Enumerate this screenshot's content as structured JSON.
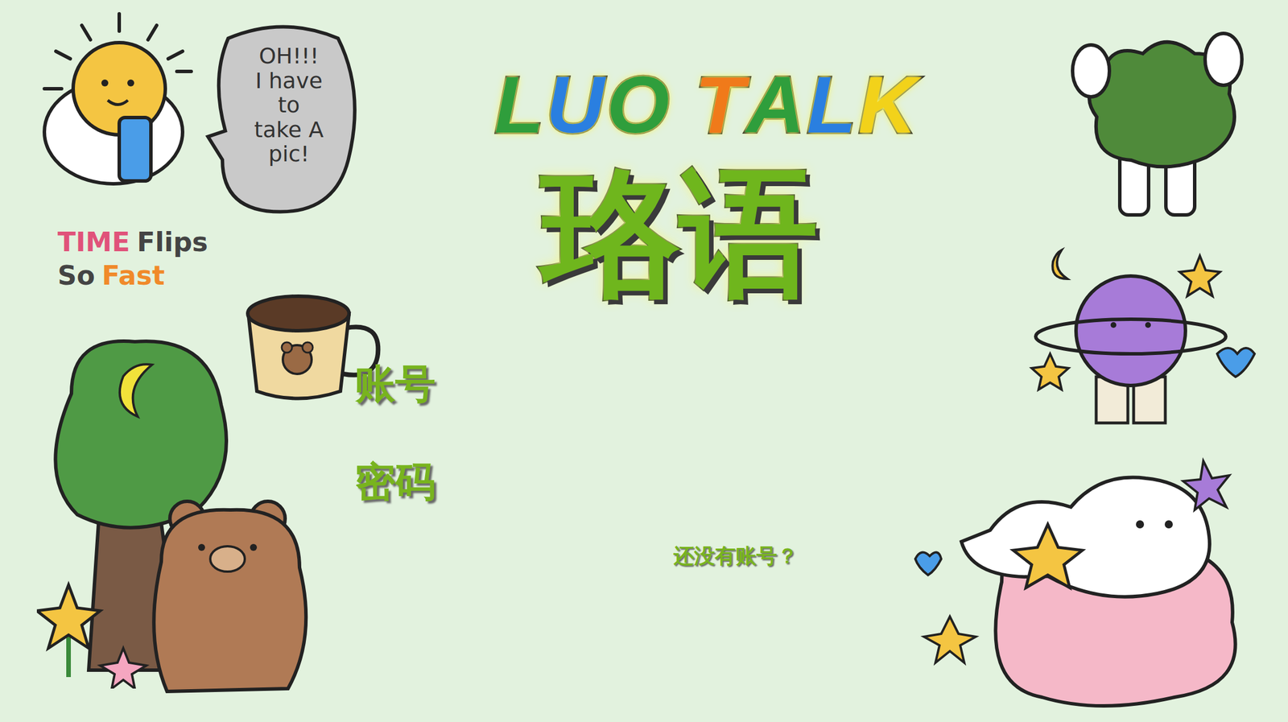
{
  "logo": {
    "words": [
      {
        "letters": [
          {
            "char": "L",
            "color": "#2f9e3c"
          },
          {
            "char": "U",
            "color": "#2a7fe0"
          },
          {
            "char": "O",
            "color": "#2f9e3c"
          }
        ]
      },
      {
        "letters": [
          {
            "char": "T",
            "color": "#f07a1a"
          },
          {
            "char": "A",
            "color": "#2f9e3c"
          },
          {
            "char": "L",
            "color": "#2a7fe0"
          },
          {
            "char": "K",
            "color": "#f2d21a"
          }
        ]
      }
    ]
  },
  "title": "珞语",
  "form": {
    "fields": [
      {
        "label": "账号",
        "kind": "text"
      },
      {
        "label": "密码",
        "kind": "password"
      }
    ]
  },
  "register_link": "还没有账号？",
  "stickers": {
    "speech_bubble": {
      "lines": [
        "OH!!!",
        "I have",
        "to",
        "take A",
        "pic!"
      ]
    },
    "caption": {
      "lines": [
        [
          {
            "text": "TIME",
            "color": "#e0527a"
          },
          {
            "text": "Flips",
            "color": "#444444"
          }
        ],
        [
          {
            "text": "So",
            "color": "#444444"
          },
          {
            "text": "Fast",
            "color": "#f08a2a"
          }
        ]
      ]
    }
  }
}
